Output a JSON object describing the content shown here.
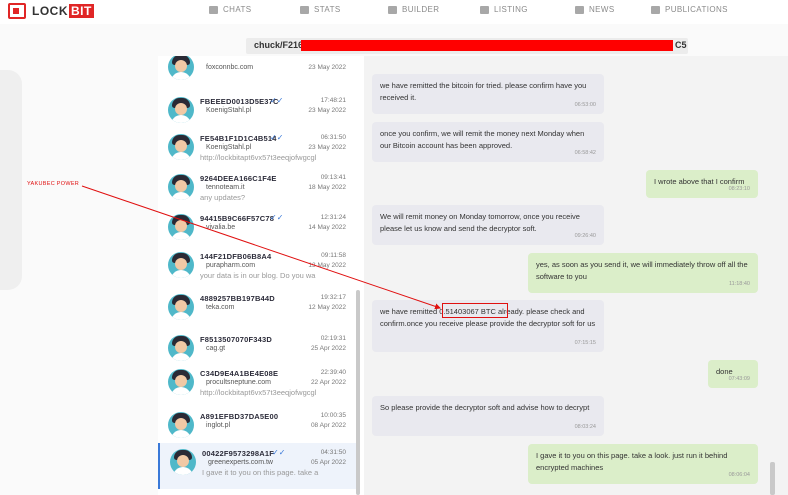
{
  "brand": {
    "logo_text_a": "LOCK",
    "logo_text_b": "BIT"
  },
  "nav": [
    {
      "label": "CHATS",
      "icon": "chat-icon"
    },
    {
      "label": "STATS",
      "icon": "stats-icon"
    },
    {
      "label": "BUILDER",
      "icon": "builder-icon"
    },
    {
      "label": "LISTING",
      "icon": "listing-icon"
    },
    {
      "label": "NEWS",
      "icon": "news-icon"
    },
    {
      "label": "PUBLICATIONS",
      "icon": "publications-icon"
    }
  ],
  "address": {
    "prefix": "chuck/F216",
    "suffix": "C5"
  },
  "annotation": {
    "label": "YAKUBEC POWER",
    "highlight_color": "#e01010"
  },
  "conversations": [
    {
      "name": "",
      "host": "foxconnbc.com",
      "preview": "",
      "time": "",
      "date": "23 May 2022",
      "check": ""
    },
    {
      "name": "FBEEED0013D5E37C",
      "host": "KoenigStahl.pl",
      "preview": "",
      "time": "17:48:21",
      "date": "23 May 2022",
      "check": "✓✓"
    },
    {
      "name": "FE54B1F1D1C4B514",
      "host": "KoenigStahl.pl",
      "preview": "http://lockbitapt6vx57t3eeqjofwgcgl",
      "time": "06:31:50",
      "date": "23 May 2022",
      "check": "✓✓"
    },
    {
      "name": "9264DEEA166C1F4E",
      "host": "tennoteam.it",
      "preview": "any updates?",
      "time": "09:13:41",
      "date": "18 May 2022",
      "check": ""
    },
    {
      "name": "94415B9C66F57C78",
      "host": "vivalia.be",
      "preview": "",
      "time": "12:31:24",
      "date": "14 May 2022",
      "check": "✓✓"
    },
    {
      "name": "144F21DFB06B8A4",
      "host": "purapharm.com",
      "preview": "your data is in our blog. Do you wa",
      "time": "09:11:58",
      "date": "13 May 2022",
      "check": ""
    },
    {
      "name": "4889257BB197B44D",
      "host": "teka.com",
      "preview": "",
      "time": "19:32:17",
      "date": "12 May 2022",
      "check": ""
    },
    {
      "name": "F8513507070F343D",
      "host": "cag.gt",
      "preview": "",
      "time": "02:19:31",
      "date": "25 Apr 2022",
      "check": ""
    },
    {
      "name": "C34D9E4A1BE4E08E",
      "host": "procultsneptune.com",
      "preview": "http://lockbitapt6vx57t3eeqjofwgcgl",
      "time": "22:39:40",
      "date": "22 Apr 2022",
      "check": ""
    },
    {
      "name": "A891EFBD37DA5E00",
      "host": "inglot.pl",
      "preview": "",
      "time": "10:00:35",
      "date": "08 Apr 2022",
      "check": ""
    },
    {
      "name": "00422F9573298A1F",
      "host": "greenexperts.com.tw",
      "preview": "I gave it to you on this page. take a",
      "time": "04:31:50",
      "date": "05 Apr 2022",
      "check": "✓✓"
    }
  ],
  "messages": [
    {
      "dir": "in",
      "text": "we have remitted the bitcoin for tried. please confirm have you received it.",
      "time": "06:53:00"
    },
    {
      "dir": "in",
      "text": "once you confirm, we will remit the money next Monday when our Bitcoin account has been approved.",
      "time": "06:58:42"
    },
    {
      "dir": "out",
      "text": "I wrote above that I confirm",
      "time": "08:23:10"
    },
    {
      "dir": "in",
      "text": "We will remit money on Monday tomorrow, once you receive please let us know and send the decryptor soft.",
      "time": "09:26:40"
    },
    {
      "dir": "out",
      "text": "yes, as soon as you send it, we will immediately throw off all the software to you",
      "time": "11:18:40"
    },
    {
      "dir": "in",
      "text_a": "we have remitted ",
      "text_b": "0.51403067 BTC",
      "text_c": " already. please check and confirm.once you receive please provide the decryptor soft for us",
      "time": "07:15:15"
    },
    {
      "dir": "out",
      "text": "done",
      "time": "07:43:09"
    },
    {
      "dir": "in",
      "text": "So please provide the decryptor soft and advise how to decrypt",
      "time": "08:03:24"
    },
    {
      "dir": "out",
      "text": "I gave it to you on this page. take a look. just run it behind encrypted machines",
      "time": "08:06:04"
    }
  ]
}
